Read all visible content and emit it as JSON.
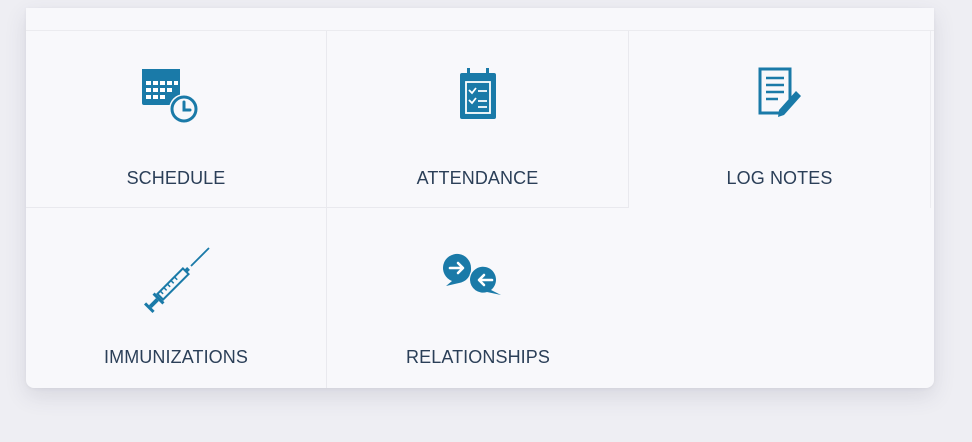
{
  "theme": {
    "icon_color": "#1a7aa8",
    "label_color": "#2b3f58",
    "background": "#eeeef3",
    "card_background": "#f8f8fb"
  },
  "tiles": [
    {
      "label": "SCHEDULE",
      "icon": "calendar-clock-icon"
    },
    {
      "label": "ATTENDANCE",
      "icon": "calendar-checklist-icon"
    },
    {
      "label": "LOG NOTES",
      "icon": "notes-pencil-icon"
    },
    {
      "label": "IMMUNIZATIONS",
      "icon": "syringe-icon"
    },
    {
      "label": "RELATIONSHIPS",
      "icon": "chat-bubbles-exchange-icon"
    }
  ]
}
